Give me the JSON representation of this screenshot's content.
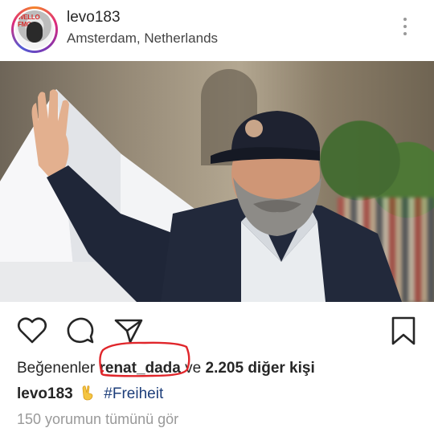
{
  "header": {
    "username": "levo183",
    "location": "Amsterdam, Netherlands",
    "avatar_text": "WELLO FMO",
    "more_icon": "more-vertical-icon"
  },
  "post": {
    "image_description_icon": "photo",
    "actions": {
      "like_icon": "heart-icon",
      "comment_icon": "comment-icon",
      "share_icon": "send-icon",
      "save_icon": "bookmark-icon"
    },
    "likes": {
      "prefix": "Beğenenler",
      "highlighted_user": "renat_dada",
      "connector": "ve",
      "others": "2.205 diğer kişi"
    },
    "caption": {
      "username": "levo183",
      "emoji": "victory-hand-icon",
      "hashtag": "#Freiheit"
    },
    "comments_link": "150 yorumun tümünü gör"
  },
  "colors": {
    "hashtag": "#1d3e7a",
    "annotation_red": "#e0262b",
    "muted": "#999999"
  }
}
